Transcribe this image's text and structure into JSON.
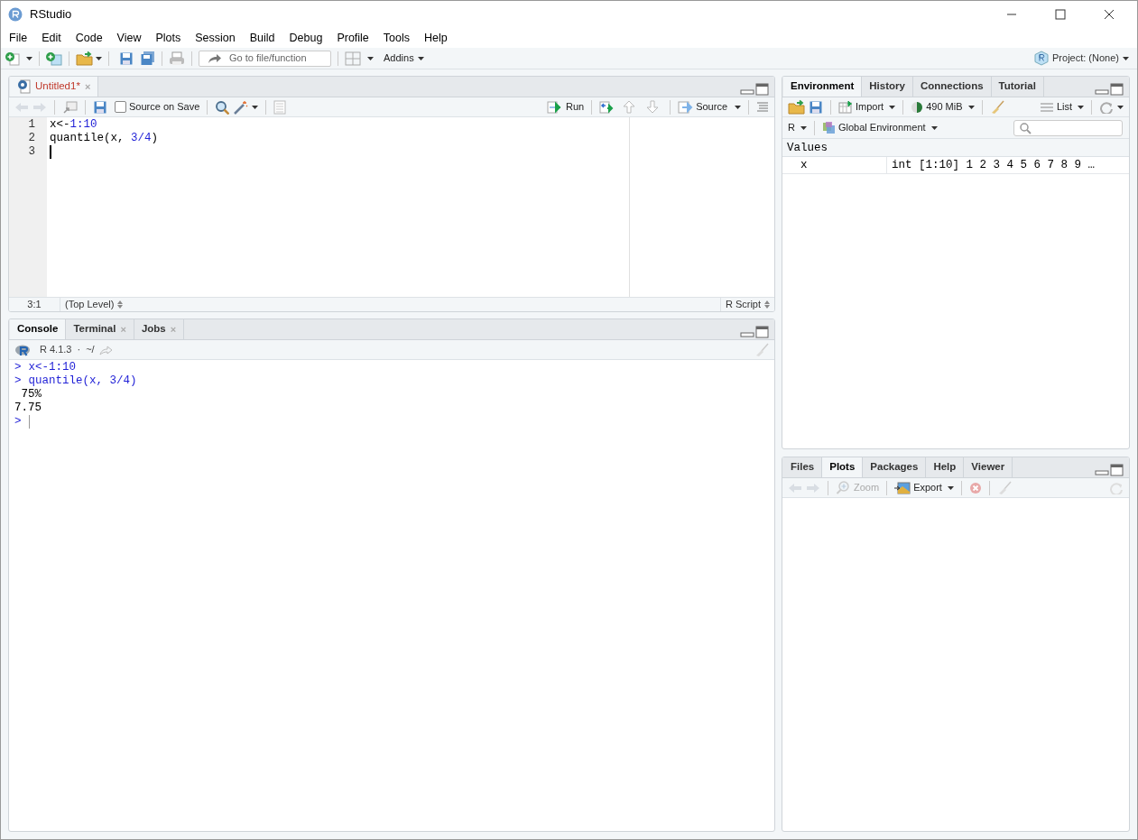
{
  "window": {
    "title": "RStudio"
  },
  "menu": [
    "File",
    "Edit",
    "Code",
    "View",
    "Plots",
    "Session",
    "Build",
    "Debug",
    "Profile",
    "Tools",
    "Help"
  ],
  "toolbar": {
    "goto_placeholder": "Go to file/function",
    "addins": "Addins",
    "project": "Project: (None)"
  },
  "source_pane": {
    "tabs": [
      {
        "label": "Untitled1*",
        "selected": true,
        "modified": true,
        "close_glyph": "×"
      }
    ],
    "source_on_save": {
      "label": "Source on Save",
      "checked": false
    },
    "run": "Run",
    "source": "Source",
    "lines": [
      {
        "number": "1",
        "cursor": false,
        "tokens": [
          {
            "kind": "plain",
            "text": "x<-"
          },
          {
            "kind": "number",
            "text": "1:10"
          }
        ]
      },
      {
        "number": "2",
        "cursor": false,
        "tokens": [
          {
            "kind": "plain",
            "text": "quantile(x, "
          },
          {
            "kind": "number",
            "text": "3/4"
          },
          {
            "kind": "plain",
            "text": ")"
          }
        ]
      },
      {
        "number": "3",
        "cursor": true
      }
    ],
    "status": {
      "position": "3:1",
      "scope": "(Top Level)",
      "file_type": "R Script"
    }
  },
  "console_pane": {
    "tabs": [
      {
        "label": "Console",
        "selected": true
      },
      {
        "label": "Terminal",
        "selected": false,
        "close_glyph": "×"
      },
      {
        "label": "Jobs",
        "selected": false,
        "close_glyph": "×"
      }
    ],
    "version": "R 4.1.3",
    "separator": "·",
    "path": "~/",
    "lines": [
      {
        "kind": "input",
        "prompt": ">",
        "text": "x<-1:10"
      },
      {
        "kind": "input",
        "prompt": ">",
        "text": "quantile(x, 3/4)"
      },
      {
        "kind": "output",
        "text": " 75%"
      },
      {
        "kind": "output",
        "text": "7.75"
      },
      {
        "kind": "prompt",
        "prompt": ">"
      }
    ]
  },
  "environment_pane": {
    "tabs": [
      {
        "label": "Environment",
        "selected": true
      },
      {
        "label": "History",
        "selected": false
      },
      {
        "label": "Connections",
        "selected": false
      },
      {
        "label": "Tutorial",
        "selected": false
      }
    ],
    "import": "Import",
    "memory": "490 MiB",
    "view": "List",
    "language": "R",
    "scope": "Global Environment",
    "section": "Values",
    "rows": [
      {
        "name": "x",
        "value": "int [1:10] 1 2 3 4 5 6 7 8 9 …"
      }
    ]
  },
  "files_pane": {
    "tabs": [
      {
        "label": "Files",
        "selected": false
      },
      {
        "label": "Plots",
        "selected": true
      },
      {
        "label": "Packages",
        "selected": false
      },
      {
        "label": "Help",
        "selected": false
      },
      {
        "label": "Viewer",
        "selected": false
      }
    ],
    "zoom": {
      "label": "Zoom",
      "disabled": true
    },
    "export": "Export"
  }
}
